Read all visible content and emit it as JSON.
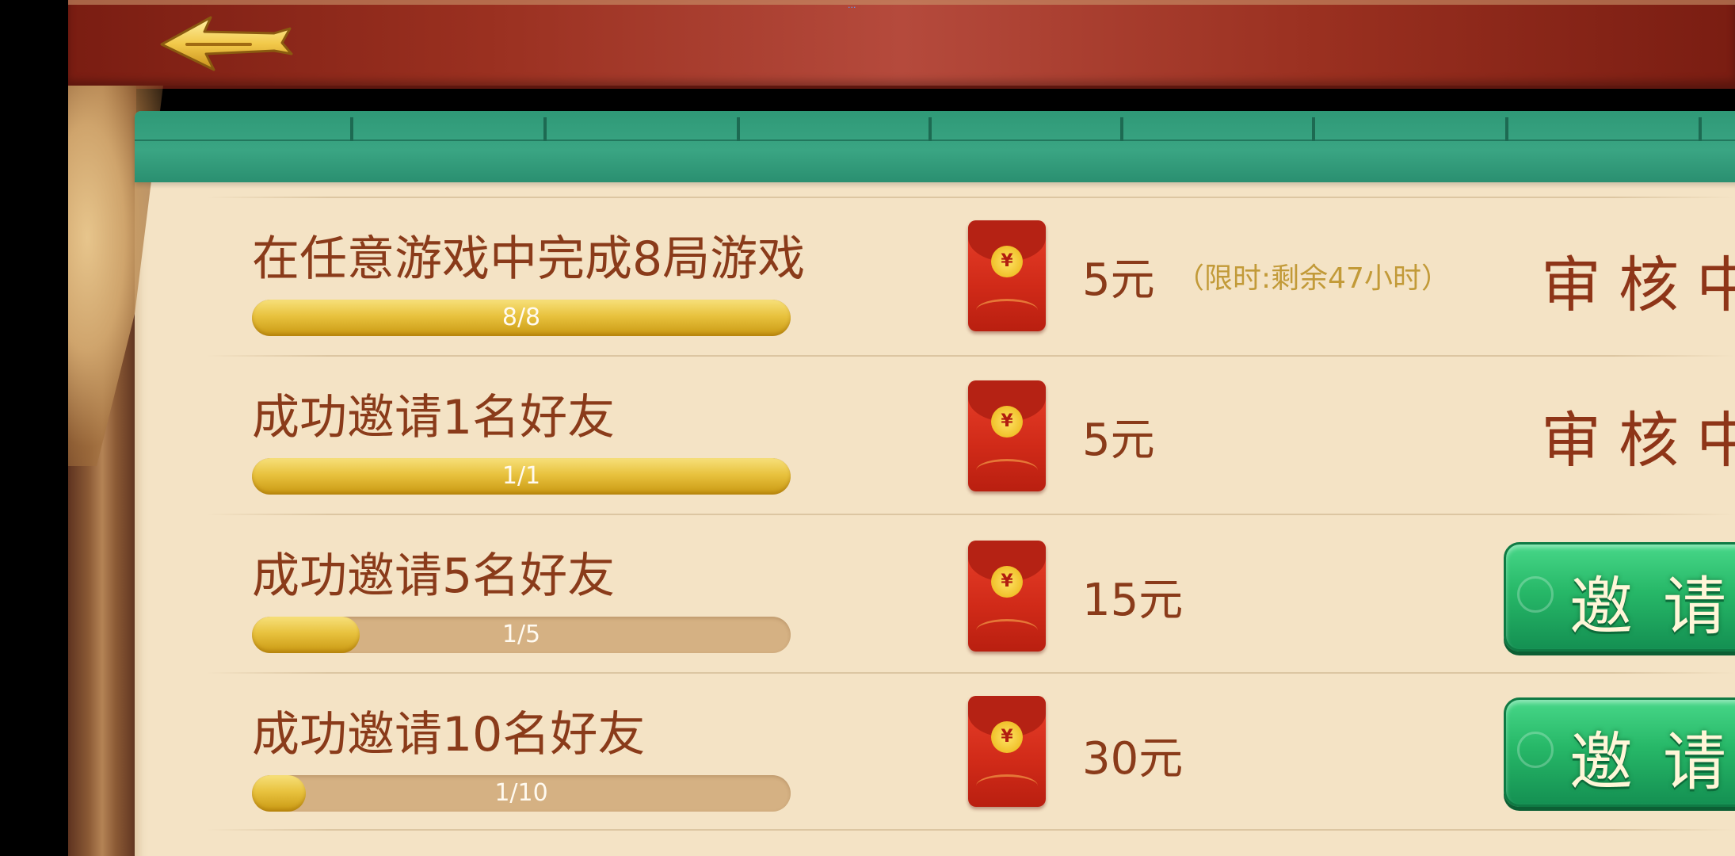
{
  "header": {
    "top_note": "...",
    "back_icon": "back-arrow-icon"
  },
  "tasks": [
    {
      "title": "在任意游戏中完成8局游戏",
      "progress_text": "8/8",
      "progress": 1.0,
      "reward": "5元",
      "reward_note": "（限时:剩余47小时）",
      "status": "审核中"
    },
    {
      "title": "成功邀请1名好友",
      "progress_text": "1/1",
      "progress": 1.0,
      "reward": "5元",
      "status": "审核中"
    },
    {
      "title": "成功邀请5名好友",
      "progress_text": "1/5",
      "progress": 0.2,
      "reward": "15元",
      "button_label": "邀请"
    },
    {
      "title": "成功邀请10名好友",
      "progress_text": "1/10",
      "progress": 0.1,
      "reward": "30元",
      "button_label": "邀请"
    }
  ],
  "icons": {
    "redpacket": "red-envelope-icon",
    "coin_symbol": "¥"
  },
  "colors": {
    "title_text": "#8a3b1a",
    "header_green": "#3aa583",
    "progress_gold": "#e8c23e",
    "button_green": "#27b868",
    "topbar_red": "#9a3020"
  }
}
